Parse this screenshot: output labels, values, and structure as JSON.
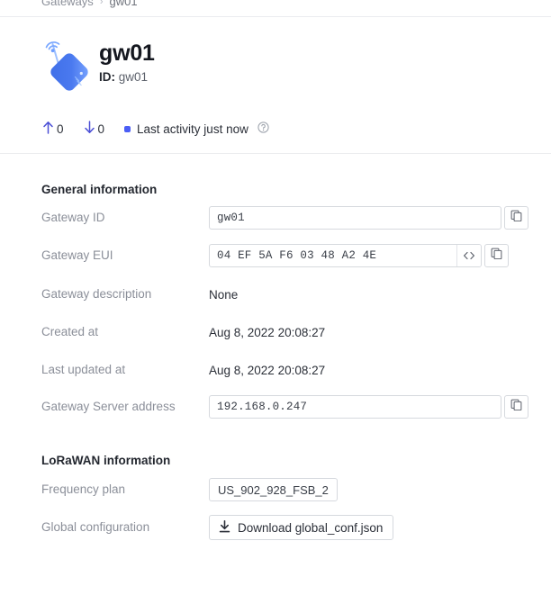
{
  "breadcrumb": {
    "parent": "Gateways",
    "separator": "›",
    "current": "gw01"
  },
  "header": {
    "icon": "gateway-icon",
    "title": "gw01",
    "id_prefix": "ID:",
    "id_value": "gw01"
  },
  "stats": {
    "uplink": {
      "icon": "arrow-up-icon",
      "count": "0"
    },
    "downlink": {
      "icon": "arrow-down-icon",
      "count": "0"
    },
    "status": {
      "dot_color": "#4b5ef5",
      "text": "Last activity just now",
      "help_icon": "help-circle-icon"
    }
  },
  "general": {
    "title": "General information",
    "rows": [
      {
        "label": "Gateway ID",
        "value": "gw01",
        "type": "input",
        "copy": true,
        "copy_icon": "copy-icon"
      },
      {
        "label": "Gateway EUI",
        "value": "04 EF 5A F6 03 48 A2 4E",
        "type": "input",
        "toggle_icon": "code-brackets-icon",
        "copy": true,
        "copy_icon": "copy-icon"
      },
      {
        "label": "Gateway description",
        "value": "None",
        "type": "text"
      },
      {
        "label": "Created at",
        "value": "Aug 8, 2022 20:08:27",
        "type": "text"
      },
      {
        "label": "Last updated at",
        "value": "Aug 8, 2022 20:08:27",
        "type": "text"
      },
      {
        "label": "Gateway Server address",
        "value": "192.168.0.247",
        "type": "input",
        "copy": true,
        "copy_icon": "copy-icon"
      }
    ]
  },
  "lorawan": {
    "title": "LoRaWAN information",
    "frequency_plan": {
      "label": "Frequency plan",
      "value": "US_902_928_FSB_2"
    },
    "global_config": {
      "label": "Global configuration",
      "button_label": "Download global_conf.json",
      "button_icon": "download-icon"
    }
  }
}
